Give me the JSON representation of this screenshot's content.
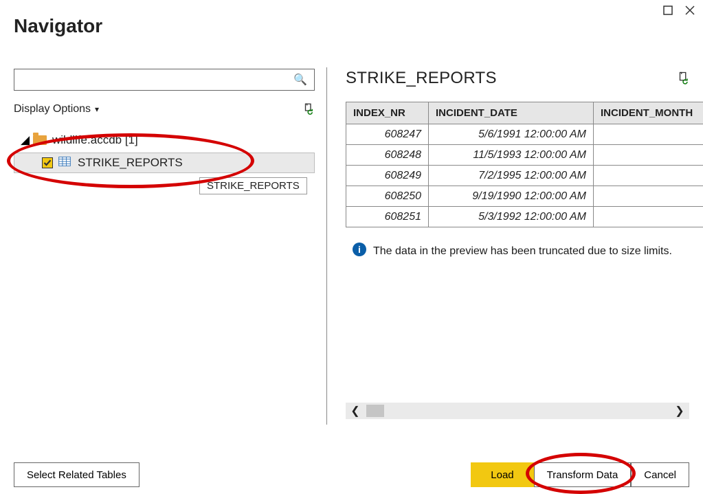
{
  "window_title": "Navigator",
  "search": {
    "placeholder": ""
  },
  "display_options_label": "Display Options",
  "tree": {
    "database_label": "wildlife.accdb [1]",
    "item_label": "STRIKE_REPORTS",
    "tooltip": "STRIKE_REPORTS"
  },
  "preview": {
    "title": "STRIKE_REPORTS",
    "columns": [
      "INDEX_NR",
      "INCIDENT_DATE",
      "INCIDENT_MONTH"
    ],
    "col_widths": [
      "120",
      "240",
      "160"
    ],
    "rows": [
      [
        "608247",
        "5/6/1991 12:00:00 AM",
        ""
      ],
      [
        "608248",
        "11/5/1993 12:00:00 AM",
        ""
      ],
      [
        "608249",
        "7/2/1995 12:00:00 AM",
        ""
      ],
      [
        "608250",
        "9/19/1990 12:00:00 AM",
        ""
      ],
      [
        "608251",
        "5/3/1992 12:00:00 AM",
        ""
      ]
    ],
    "info_message": "The data in the preview has been truncated due to size limits."
  },
  "buttons": {
    "select_related": "Select Related Tables",
    "load": "Load",
    "transform": "Transform Data",
    "cancel": "Cancel"
  }
}
